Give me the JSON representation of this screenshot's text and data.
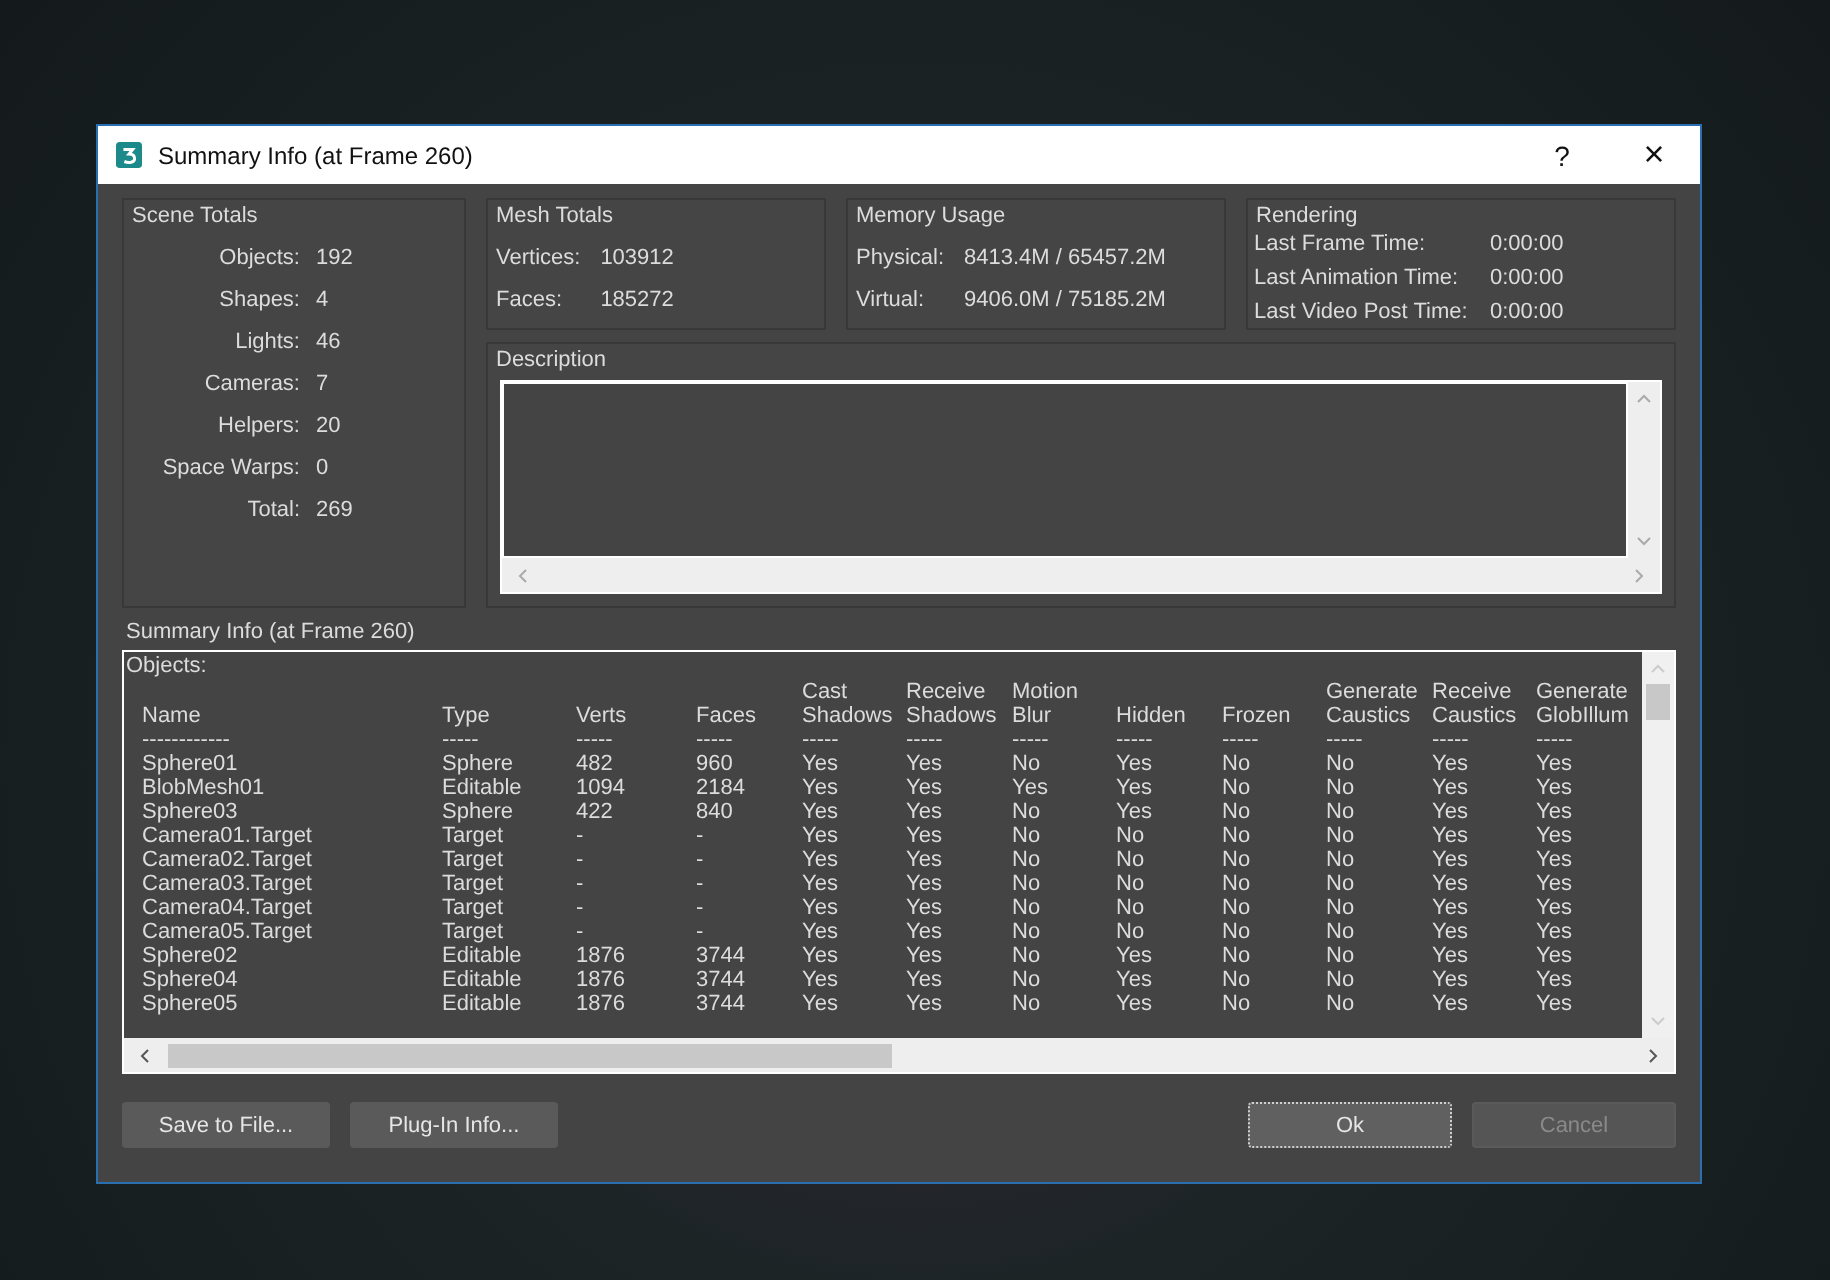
{
  "window": {
    "title": "Summary Info (at Frame 260)",
    "help": "?",
    "close": "×"
  },
  "scene_totals": {
    "title": "Scene Totals",
    "items": [
      {
        "label": "Objects:",
        "value": "192"
      },
      {
        "label": "Shapes:",
        "value": "4"
      },
      {
        "label": "Lights:",
        "value": "46"
      },
      {
        "label": "Cameras:",
        "value": "7"
      },
      {
        "label": "Helpers:",
        "value": "20"
      },
      {
        "label": "Space Warps:",
        "value": "0"
      },
      {
        "label": "Total:",
        "value": "269"
      }
    ]
  },
  "mesh_totals": {
    "title": "Mesh Totals",
    "items": [
      {
        "label": "Vertices:",
        "value": "103912"
      },
      {
        "label": "Faces:",
        "value": "185272"
      }
    ]
  },
  "memory_usage": {
    "title": "Memory Usage",
    "items": [
      {
        "label": "Physical:",
        "value": "8413.4M / 65457.2M"
      },
      {
        "label": "Virtual:",
        "value": "9406.0M / 75185.2M"
      }
    ]
  },
  "rendering": {
    "title": "Rendering",
    "items": [
      {
        "label": "Last Frame Time:",
        "value": "0:00:00"
      },
      {
        "label": "Last Animation Time:",
        "value": "0:00:00"
      },
      {
        "label": "Last Video Post Time:",
        "value": "0:00:00"
      }
    ]
  },
  "description": {
    "title": "Description"
  },
  "summary": {
    "title": "Summary Info (at Frame 260)",
    "heading": "Objects:",
    "columns": [
      {
        "label": "Name",
        "dashes": "------------"
      },
      {
        "label": "Type",
        "dashes": "-----"
      },
      {
        "label": "Verts",
        "dashes": "-----"
      },
      {
        "label": "Faces",
        "dashes": "-----"
      },
      {
        "top": "Cast",
        "label": "Shadows",
        "dashes": "-----"
      },
      {
        "top": "Receive",
        "label": "Shadows",
        "dashes": "-----"
      },
      {
        "top": "Motion",
        "label": "Blur",
        "dashes": "-----"
      },
      {
        "label": "Hidden",
        "dashes": "-----"
      },
      {
        "label": "Frozen",
        "dashes": "-----"
      },
      {
        "top": "Generate",
        "label": "Caustics",
        "dashes": "-----"
      },
      {
        "top": "Receive",
        "label": "Caustics",
        "dashes": "-----"
      },
      {
        "top": "Generate",
        "label": "GlobIllum",
        "dashes": "-----"
      }
    ],
    "rows": [
      [
        "Sphere01",
        "Sphere",
        "482",
        "960",
        "Yes",
        "Yes",
        "No",
        "Yes",
        "No",
        "No",
        "Yes",
        "Yes"
      ],
      [
        "BlobMesh01",
        "Editable",
        "1094",
        "2184",
        "Yes",
        "Yes",
        "Yes",
        "Yes",
        "No",
        "No",
        "Yes",
        "Yes"
      ],
      [
        "Sphere03",
        "Sphere",
        "422",
        "840",
        "Yes",
        "Yes",
        "No",
        "Yes",
        "No",
        "No",
        "Yes",
        "Yes"
      ],
      [
        "Camera01.Target",
        "Target",
        "-",
        "-",
        "Yes",
        "Yes",
        "No",
        "No",
        "No",
        "No",
        "Yes",
        "Yes"
      ],
      [
        "Camera02.Target",
        "Target",
        "-",
        "-",
        "Yes",
        "Yes",
        "No",
        "No",
        "No",
        "No",
        "Yes",
        "Yes"
      ],
      [
        "Camera03.Target",
        "Target",
        "-",
        "-",
        "Yes",
        "Yes",
        "No",
        "No",
        "No",
        "No",
        "Yes",
        "Yes"
      ],
      [
        "Camera04.Target",
        "Target",
        "-",
        "-",
        "Yes",
        "Yes",
        "No",
        "No",
        "No",
        "No",
        "Yes",
        "Yes"
      ],
      [
        "Camera05.Target",
        "Target",
        "-",
        "-",
        "Yes",
        "Yes",
        "No",
        "No",
        "No",
        "No",
        "Yes",
        "Yes"
      ],
      [
        "Sphere02",
        "Editable",
        "1876",
        "3744",
        "Yes",
        "Yes",
        "No",
        "Yes",
        "No",
        "No",
        "Yes",
        "Yes"
      ],
      [
        "Sphere04",
        "Editable",
        "1876",
        "3744",
        "Yes",
        "Yes",
        "No",
        "Yes",
        "No",
        "No",
        "Yes",
        "Yes"
      ],
      [
        "Sphere05",
        "Editable",
        "1876",
        "3744",
        "Yes",
        "Yes",
        "No",
        "Yes",
        "No",
        "No",
        "Yes",
        "Yes"
      ]
    ]
  },
  "buttons_left": [
    {
      "label": "Save to File...",
      "focused": false,
      "disabled": false
    },
    {
      "label": "Plug-In Info...",
      "focused": false,
      "disabled": false
    }
  ],
  "buttons_right": [
    {
      "label": "Ok",
      "focused": true,
      "disabled": false
    },
    {
      "label": "Cancel",
      "focused": false,
      "disabled": true
    }
  ]
}
